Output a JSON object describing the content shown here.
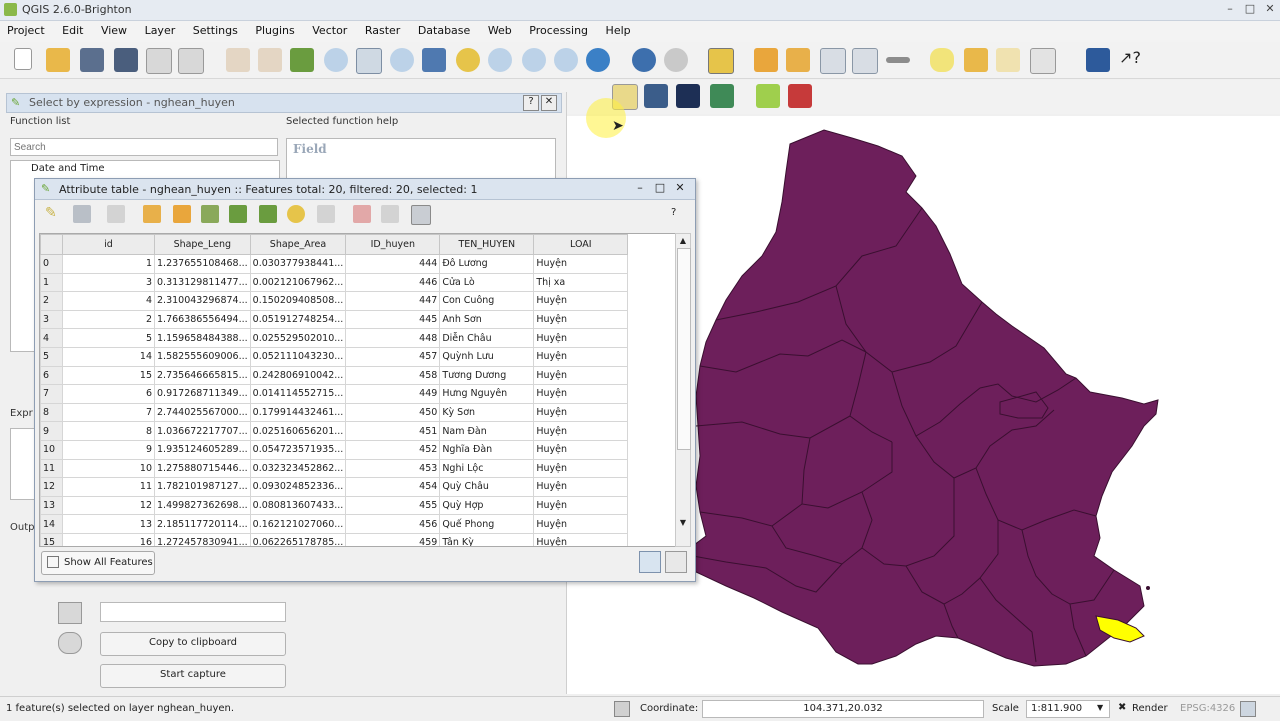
{
  "window": {
    "title": "QGIS 2.6.0-Brighton"
  },
  "menu": [
    "Project",
    "Edit",
    "View",
    "Layer",
    "Settings",
    "Plugins",
    "Vector",
    "Raster",
    "Database",
    "Web",
    "Processing",
    "Help"
  ],
  "select_dialog": {
    "title": "Select by expression - nghean_huyen",
    "function_list_label": "Function list",
    "selected_help_label": "Selected function help",
    "search_placeholder": "Search",
    "first_group": "Date and Time",
    "help_heading": "Field",
    "expr_label": "Expr",
    "output_label": "Outp",
    "copy_button": "Copy to clipboard",
    "start_capture": "Start capture"
  },
  "attribute_table": {
    "title": "Attribute table - nghean_huyen :: Features total: 20, filtered: 20, selected: 1",
    "columns": [
      "id",
      "Shape_Leng",
      "Shape_Area",
      "ID_huyen",
      "TEN_HUYEN",
      "LOAI"
    ],
    "rows": [
      [
        "0",
        "1",
        "1.237655108468...",
        "0.030377938441...",
        "444",
        "Đô Lương",
        "Huyện"
      ],
      [
        "1",
        "3",
        "0.313129811477...",
        "0.002121067962...",
        "446",
        "Cửa Lò",
        "Thị xa"
      ],
      [
        "2",
        "4",
        "2.310043296874...",
        "0.150209408508...",
        "447",
        "Con Cuông",
        "Huyện"
      ],
      [
        "3",
        "2",
        "1.766386556494...",
        "0.051912748254...",
        "445",
        "Anh Sơn",
        "Huyện"
      ],
      [
        "4",
        "5",
        "1.159658484388...",
        "0.025529502010...",
        "448",
        "Diễn Châu",
        "Huyện"
      ],
      [
        "5",
        "14",
        "1.582555609006...",
        "0.052111043230...",
        "457",
        "Quỳnh Lưu",
        "Huyện"
      ],
      [
        "6",
        "15",
        "2.735646665815...",
        "0.242806910042...",
        "458",
        "Tương Dương",
        "Huyện"
      ],
      [
        "7",
        "6",
        "0.917268711349...",
        "0.014114552715...",
        "449",
        "Hưng Nguyên",
        "Huyện"
      ],
      [
        "8",
        "7",
        "2.744025567000...",
        "0.179914432461...",
        "450",
        "Kỳ Sơn",
        "Huyện"
      ],
      [
        "9",
        "8",
        "1.036672217707...",
        "0.025160656201...",
        "451",
        "Nam Đàn",
        "Huyện"
      ],
      [
        "10",
        "9",
        "1.935124605289...",
        "0.054723571935...",
        "452",
        "Nghĩa Đàn",
        "Huyện"
      ],
      [
        "11",
        "10",
        "1.275880715446...",
        "0.032323452862...",
        "453",
        "Nghi Lộc",
        "Huyện"
      ],
      [
        "12",
        "11",
        "1.782101987127...",
        "0.093024852336...",
        "454",
        "Quỳ Châu",
        "Huyện"
      ],
      [
        "13",
        "12",
        "1.499827362698...",
        "0.080813607433...",
        "455",
        "Quỳ Hợp",
        "Huyện"
      ],
      [
        "14",
        "13",
        "2.185117720114...",
        "0.162121027060...",
        "456",
        "Quế Phong",
        "Huyện"
      ],
      [
        "15",
        "16",
        "1.272457830941...",
        "0.062265178785...",
        "459",
        "Tân Kỳ",
        "Huyện"
      ]
    ],
    "show_all": "Show All Features",
    "help_q": "?"
  },
  "status": {
    "message": "1 feature(s) selected on layer nghean_huyen.",
    "coordinate_label": "Coordinate:",
    "coordinate": "104.371,20.032",
    "scale_label": "Scale",
    "scale": "1:811.900",
    "render_label": "Render",
    "crs": "EPSG:4326"
  },
  "colors": {
    "region": "#6d1f5b",
    "selected": "#ffff00",
    "border": "#3a0f30"
  },
  "icons": [
    "new-icon",
    "open-icon",
    "save-icon",
    "save-as-icon",
    "print-composer-icon",
    "composer-manager-icon",
    "pan-icon",
    "pan-to-selection-icon",
    "zoom-in-icon",
    "zoom-out-icon",
    "zoom-full-icon",
    "zoom-layer-icon",
    "identify-icon",
    "select-icon",
    "field-calculator-icon",
    "attribute-table-icon",
    "help-icon",
    "whats-this-icon"
  ]
}
